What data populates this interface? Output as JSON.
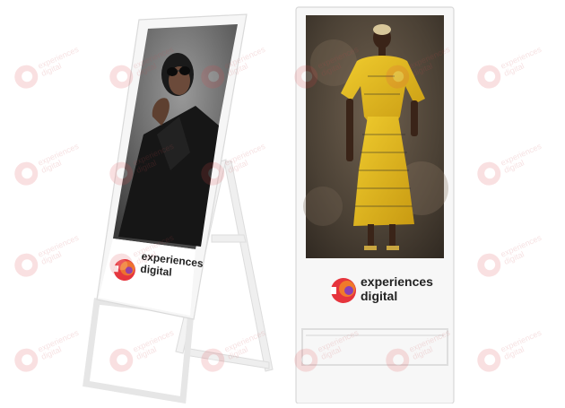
{
  "brand": {
    "line1": "experiences",
    "line2": "digital",
    "mark_colors": [
      "#e6353d",
      "#f07a2b",
      "#8b3fb5"
    ]
  },
  "watermark": {
    "text": "experiences\ndigital",
    "color": "#d94a4e"
  },
  "stands": [
    {
      "name": "folding-stand-left",
      "frame_color": "#f4f4f4",
      "screen_content": "woman-in-black-with-sunglasses"
    },
    {
      "name": "upright-stand-right",
      "frame_color": "#f7f7f7",
      "screen_content": "woman-in-yellow-dress"
    }
  ]
}
